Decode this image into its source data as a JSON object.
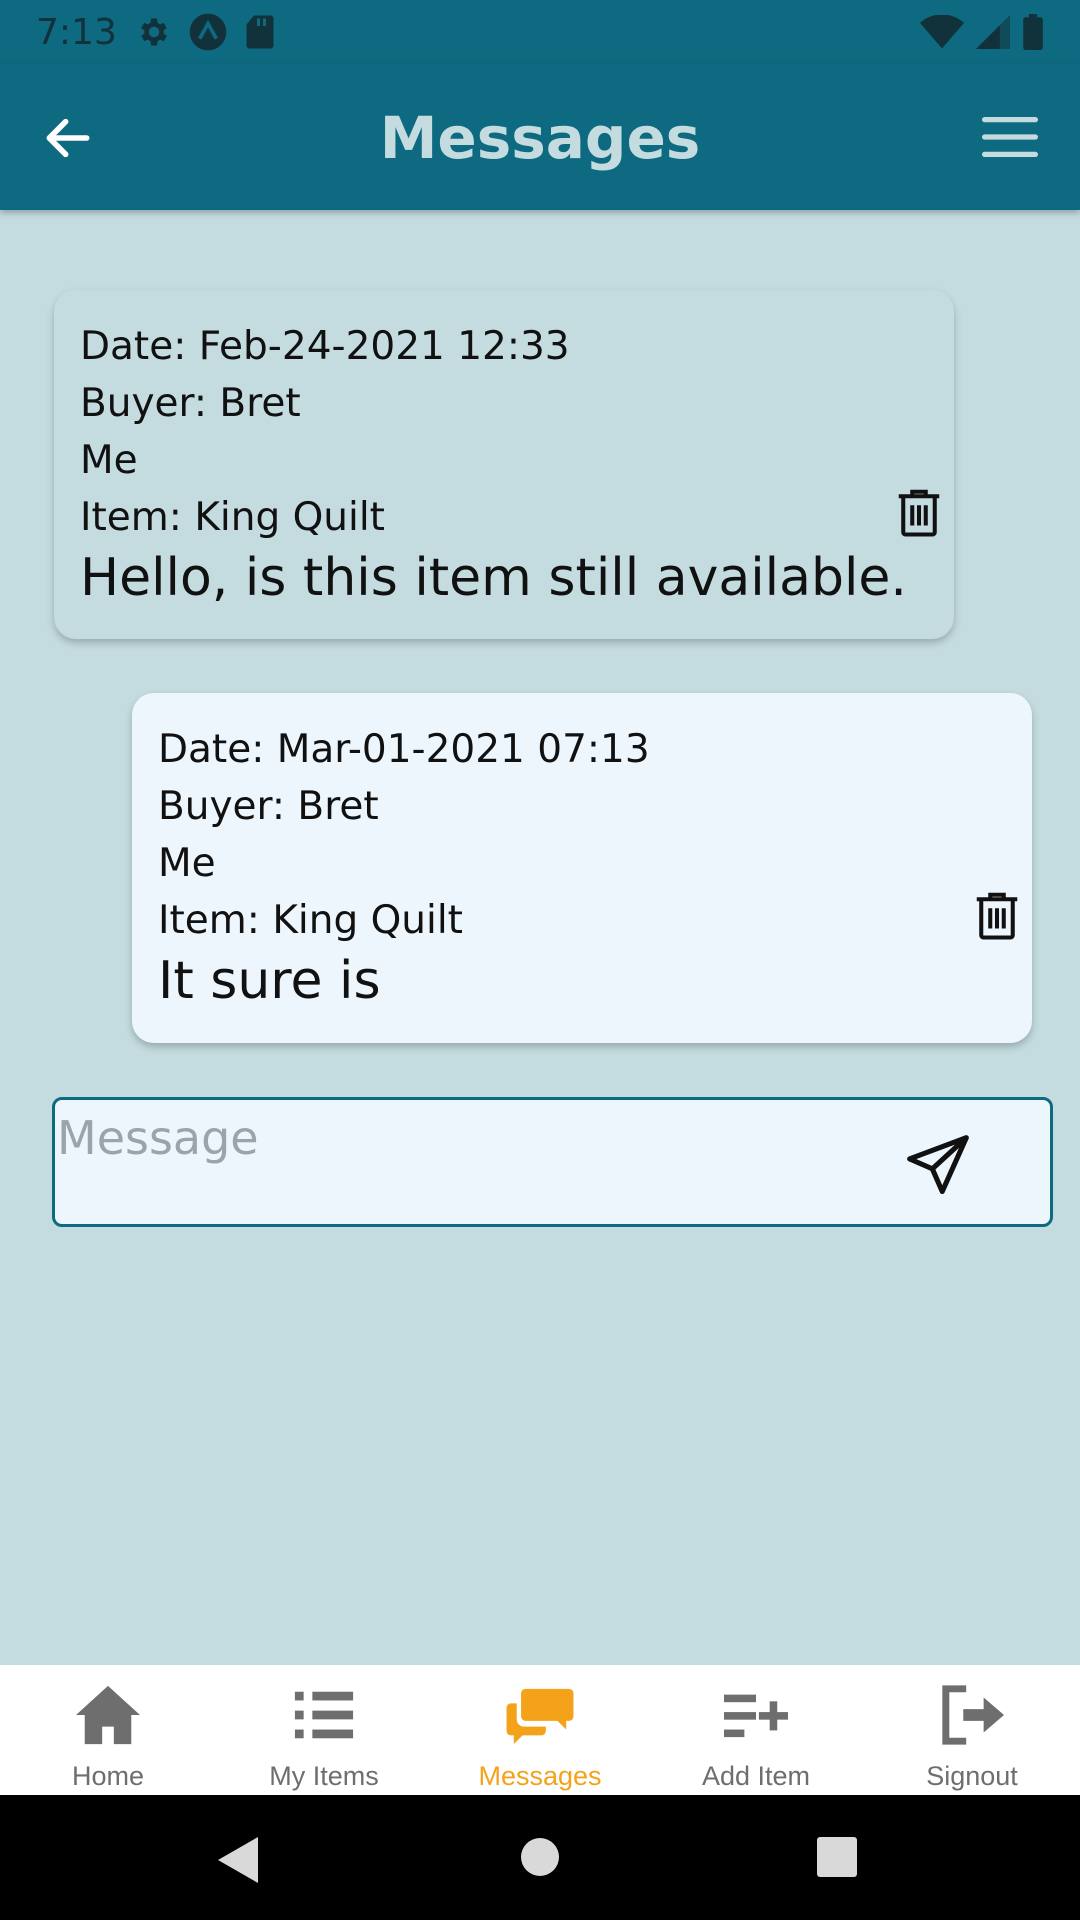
{
  "status_bar": {
    "time": "7:13",
    "icons_left": [
      "gear-icon",
      "app-badge-icon",
      "sd-card-icon"
    ],
    "icons_right": [
      "wifi-icon",
      "signal-icon",
      "battery-icon"
    ]
  },
  "app_bar": {
    "title": "Messages",
    "back_icon": "arrow-left-icon",
    "menu_icon": "hamburger-menu-icon"
  },
  "messages": [
    {
      "date": "Date: Feb-24-2021 12:33",
      "buyer": "Buyer: Bret",
      "sender": "Me",
      "item": "Item: King Quilt",
      "text": "Hello, is this item still available."
    },
    {
      "date": "Date: Mar-01-2021 07:13",
      "buyer": "Buyer: Bret",
      "sender": "Me",
      "item": "Item: King Quilt",
      "text": "It sure is"
    }
  ],
  "composer": {
    "placeholder": "Message",
    "value": ""
  },
  "bottom_nav": {
    "items": [
      {
        "label": "Home",
        "icon": "home-icon"
      },
      {
        "label": "My Items",
        "icon": "list-icon"
      },
      {
        "label": "Messages",
        "icon": "chat-bubbles-icon",
        "active": true
      },
      {
        "label": "Add Item",
        "icon": "list-add-icon"
      },
      {
        "label": "Signout",
        "icon": "signout-icon"
      }
    ]
  },
  "colors": {
    "primary": "#0e6a80",
    "background": "#c4dce0",
    "card_light": "#eef6fd",
    "accent": "#f4a21a",
    "nav_inactive": "#6e6e6e"
  }
}
